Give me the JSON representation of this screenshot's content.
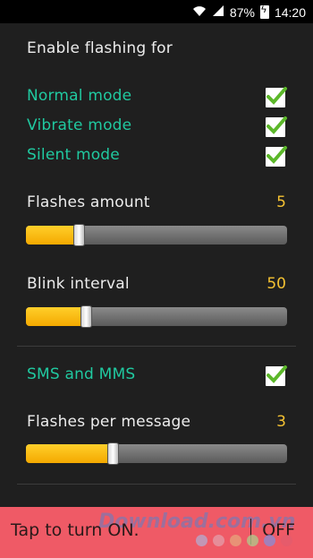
{
  "status_bar": {
    "battery": "87%",
    "time": "14:20"
  },
  "section_header": "Enable flashing for",
  "modes": [
    {
      "label": "Normal mode",
      "checked": true
    },
    {
      "label": "Vibrate mode",
      "checked": true
    },
    {
      "label": "Silent mode",
      "checked": true
    }
  ],
  "flashes_amount": {
    "label": "Flashes amount",
    "value": "5",
    "fraction": 0.18
  },
  "blink_interval": {
    "label": "Blink interval",
    "value": "50",
    "fraction": 0.21
  },
  "sms": {
    "label": "SMS and MMS",
    "checked": true
  },
  "flashes_per_message": {
    "label": "Flashes per message",
    "value": "3",
    "fraction": 0.31
  },
  "bottom": {
    "tap_label": "Tap to turn ON.",
    "off_label": "OFF"
  },
  "watermark": "Download.com.vn",
  "colors": {
    "accent_green": "#20c9a0",
    "value_yellow": "#f5c232",
    "bottom_bar": "#ef5a66"
  }
}
